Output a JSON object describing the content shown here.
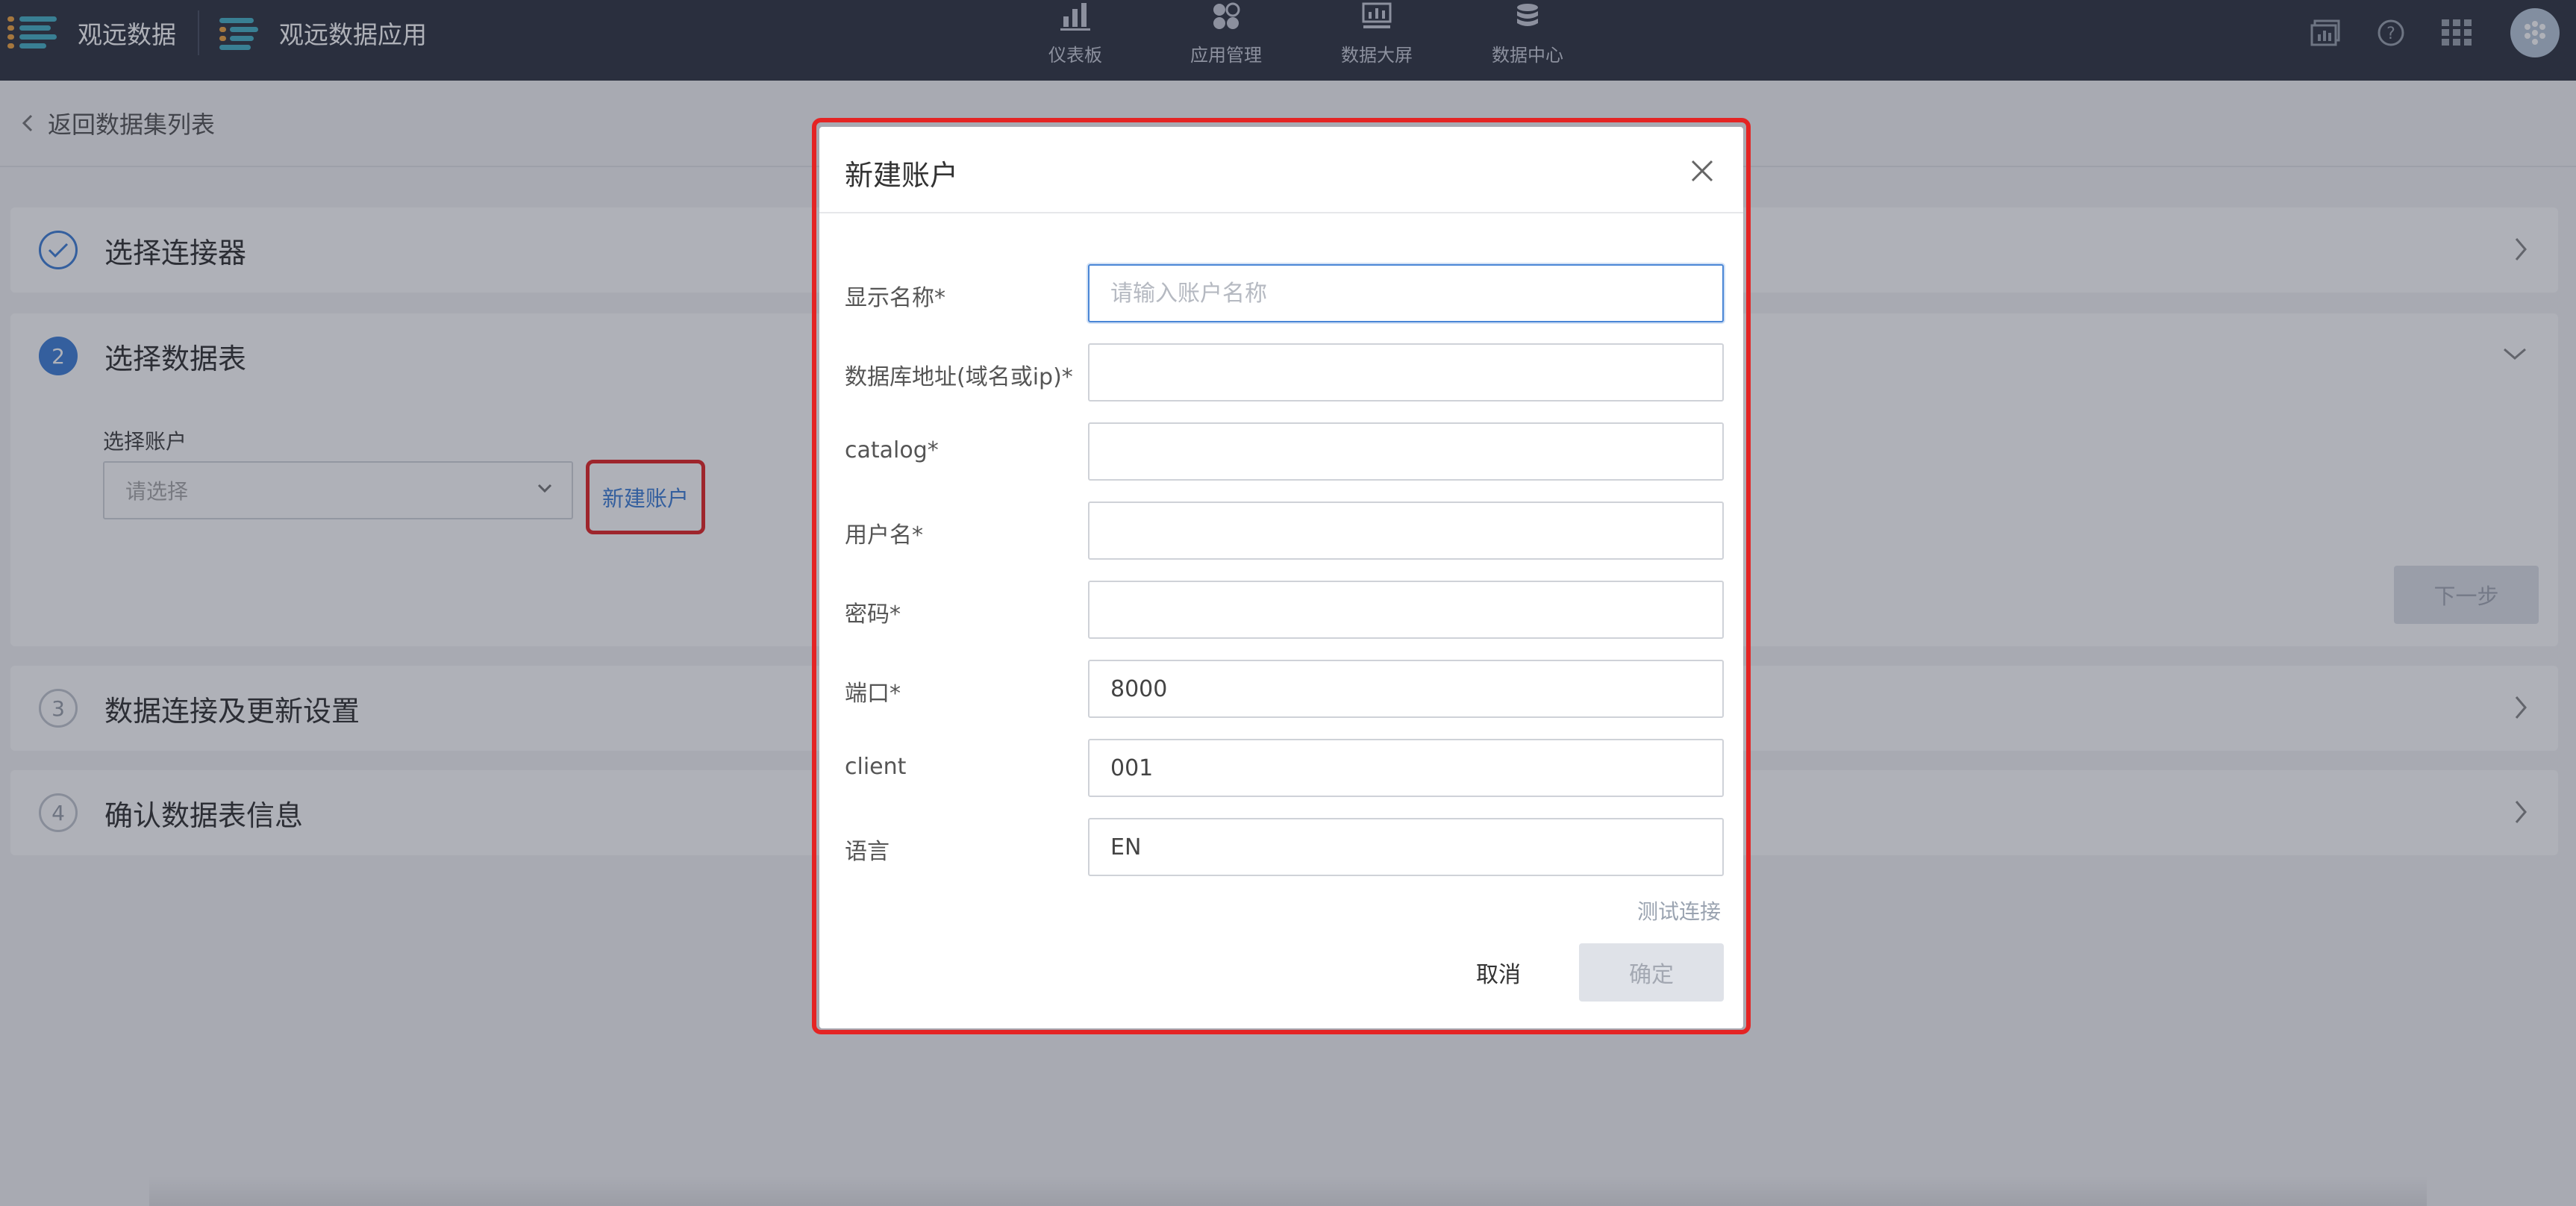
{
  "topbar": {
    "brand_name": "观远数据",
    "app_name": "观远数据应用",
    "nav": [
      {
        "label": "仪表板",
        "icon": "bar-chart-icon"
      },
      {
        "label": "应用管理",
        "icon": "apps-icon"
      },
      {
        "label": "数据大屏",
        "icon": "screen-icon"
      },
      {
        "label": "数据中心",
        "icon": "database-icon"
      }
    ],
    "right_icons": [
      "dashboard-monitor-icon",
      "help-icon",
      "grid-menu-icon",
      "user-avatar-icon"
    ]
  },
  "page": {
    "back_label": "返回数据集列表",
    "steps": [
      {
        "number": "✓",
        "title": "选择连接器",
        "state": "done"
      },
      {
        "number": "2",
        "title": "选择数据表",
        "state": "active"
      },
      {
        "number": "3",
        "title": "数据连接及更新设置",
        "state": "pending"
      },
      {
        "number": "4",
        "title": "确认数据表信息",
        "state": "pending"
      }
    ],
    "account_label": "选择账户",
    "account_placeholder": "请选择",
    "new_account_button": "新建账户",
    "next_button": "下一步"
  },
  "modal": {
    "title": "新建账户",
    "fields": [
      {
        "label": "显示名称*",
        "value": "",
        "placeholder": "请输入账户名称"
      },
      {
        "label": "数据库地址(域名或ip)*",
        "value": "",
        "placeholder": ""
      },
      {
        "label": "catalog*",
        "value": "",
        "placeholder": ""
      },
      {
        "label": "用户名*",
        "value": "",
        "placeholder": ""
      },
      {
        "label": "密码*",
        "value": "",
        "placeholder": ""
      },
      {
        "label": "端口*",
        "value": "8000",
        "placeholder": ""
      },
      {
        "label": "client",
        "value": "001",
        "placeholder": ""
      },
      {
        "label": "语言",
        "value": "EN",
        "placeholder": ""
      }
    ],
    "test_connection": "测试连接",
    "cancel": "取消",
    "ok": "确定"
  },
  "colors": {
    "topbar_bg": "#2f3541",
    "accent_blue": "#3f7fd6",
    "highlight_red": "#e42424",
    "logo_teal": "#47b1c6"
  }
}
